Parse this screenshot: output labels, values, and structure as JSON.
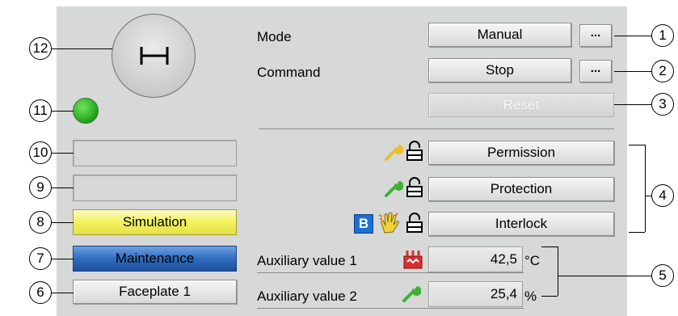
{
  "mode": {
    "label": "Mode",
    "value": "Manual",
    "more": "..."
  },
  "command": {
    "label": "Command",
    "value": "Stop",
    "more": "..."
  },
  "reset": {
    "label": "Reset"
  },
  "status_rows": [
    {
      "label": "Permission",
      "icons": [
        "wrench-icon",
        "lock-icon"
      ]
    },
    {
      "label": "Protection",
      "icons": [
        "wrench-icon",
        "lock-icon"
      ]
    },
    {
      "label": "Interlock",
      "badge": "B",
      "icons": [
        "hand-icon",
        "lock-icon"
      ]
    }
  ],
  "left_boxes": {
    "simulation": "Simulation",
    "maintenance": "Maintenance",
    "faceplate": "Faceplate 1"
  },
  "auxiliary": [
    {
      "label": "Auxiliary value 1",
      "value": "42,5",
      "unit": "°C",
      "icon": "heater-icon"
    },
    {
      "label": "Auxiliary value 2",
      "value": "25,4",
      "unit": "%",
      "icon": "wrench-icon"
    }
  ],
  "callouts": [
    "1",
    "2",
    "3",
    "4",
    "5",
    "6",
    "7",
    "8",
    "9",
    "10",
    "11",
    "12"
  ],
  "colors": {
    "panel": "#d7d8d8",
    "simulation": "#f2f25a",
    "maintenance": "#2f6dc1",
    "status_led": "#2bb52a",
    "badge": "#1f6fd1"
  }
}
